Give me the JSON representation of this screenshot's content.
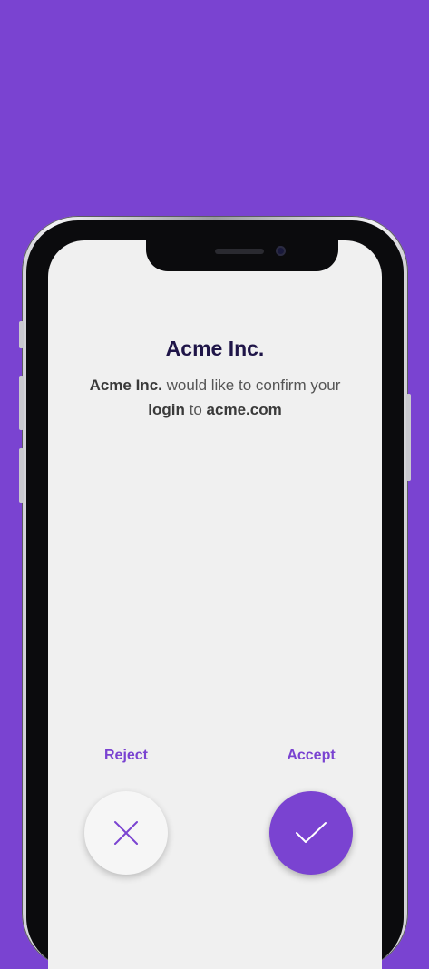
{
  "screen": {
    "title": "Acme Inc.",
    "message": {
      "app_name": "Acme Inc.",
      "text_1": "would like to confirm your",
      "action": "login",
      "text_2": "to",
      "domain": "acme.com"
    }
  },
  "actions": {
    "reject_label": "Reject",
    "accept_label": "Accept",
    "reject_icon": "close-icon",
    "accept_icon": "checkmark-icon"
  },
  "colors": {
    "background": "#7a43d1",
    "accent": "#7a43d1",
    "title": "#1f1548",
    "screen": "#f0f0f0"
  }
}
